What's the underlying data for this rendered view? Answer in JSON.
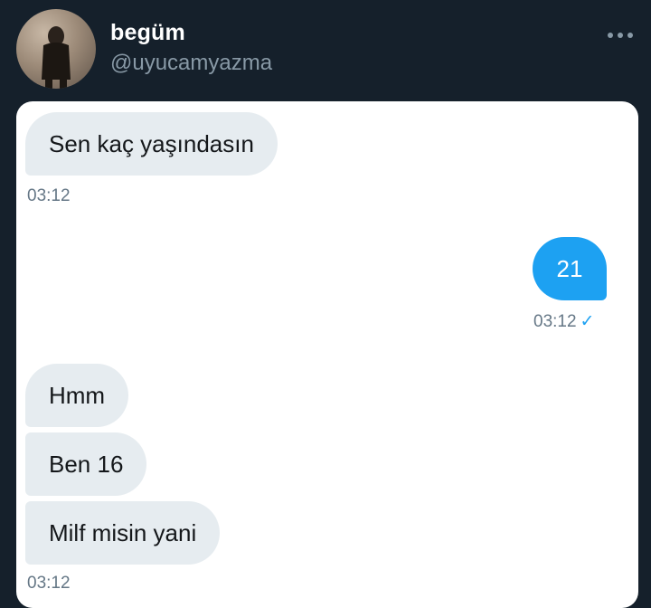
{
  "header": {
    "name": "begüm",
    "handle": "@uyucamyazma",
    "more_icon": "more-horizontal-icon"
  },
  "messages": [
    {
      "direction": "received",
      "text": "Sen kaç yaşındasın",
      "time": "03:12"
    },
    {
      "direction": "sent",
      "text": "21",
      "time": "03:12",
      "status": "✓"
    },
    {
      "direction": "received",
      "text": "Hmm"
    },
    {
      "direction": "received",
      "text": "Ben 16"
    },
    {
      "direction": "received",
      "text": "Milf misin yani",
      "time": "03:12"
    }
  ],
  "colors": {
    "background": "#15202b",
    "received_bubble": "#e6ecf0",
    "sent_bubble": "#1da1f2",
    "timestamp": "#657786"
  }
}
